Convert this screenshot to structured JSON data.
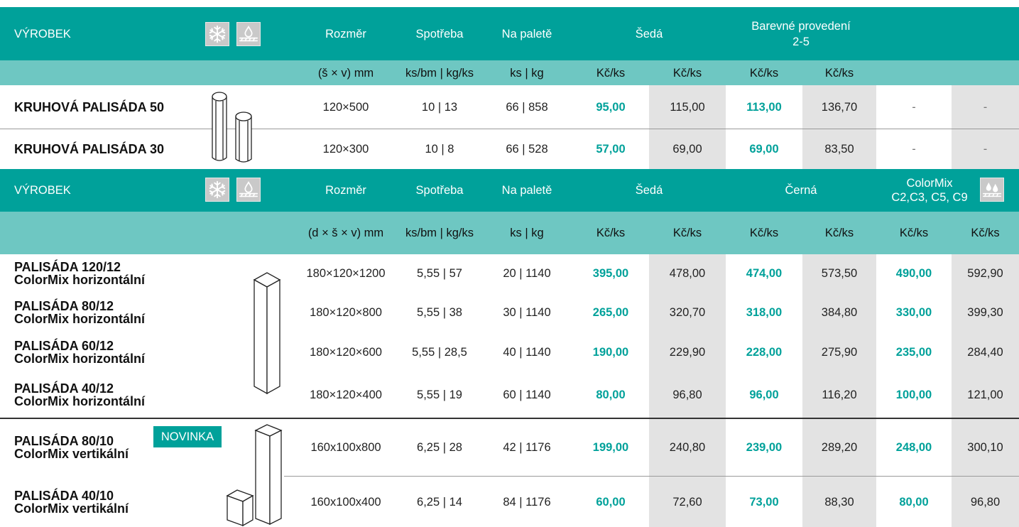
{
  "header1": {
    "vyrobek": "VÝROBEK",
    "rozmer": "Rozměr",
    "spotreba": "Spotřeba",
    "na_palete": "Na paletě",
    "seda": "Šedá",
    "barevne_1": "Barevné provedení",
    "barevne_2": "2-5"
  },
  "subheader1": {
    "rozmer_unit": "(š × v) mm",
    "spotreba_unit": "ks/bm | kg/ks",
    "palete_unit": "ks | kg",
    "price_units": [
      "Kč/ks",
      "Kč/ks",
      "Kč/ks",
      "Kč/ks"
    ]
  },
  "section1_rows": [
    {
      "name": "KRUHOVÁ PALISÁDA 50",
      "rozmer": "120×500",
      "spotreba": "10 | 13",
      "palete": "66 | 858",
      "prices": [
        "95,00",
        "115,00",
        "113,00",
        "136,70",
        "-",
        "-"
      ]
    },
    {
      "name": "KRUHOVÁ PALISÁDA 30",
      "rozmer": "120×300",
      "spotreba": "10 | 8",
      "palete": "66 | 528",
      "prices": [
        "57,00",
        "69,00",
        "69,00",
        "83,50",
        "-",
        "-"
      ]
    }
  ],
  "header2": {
    "vyrobek": "VÝROBEK",
    "rozmer": "Rozměr",
    "spotreba": "Spotřeba",
    "na_palete": "Na paletě",
    "seda": "Šedá",
    "cerna": "Černá",
    "colormix_1": "ColorMix",
    "colormix_2": "C2,C3, C5, C9"
  },
  "subheader2": {
    "rozmer_unit": "(d × š × v) mm",
    "spotreba_unit": "ks/bm | kg/ks",
    "palete_unit": "ks | kg",
    "price_units": [
      "Kč/ks",
      "Kč/ks",
      "Kč/ks",
      "Kč/ks",
      "Kč/ks",
      "Kč/ks"
    ]
  },
  "section2_rows": [
    {
      "name1": "PALISÁDA 120/12",
      "name2": "ColorMix horizontální",
      "rozmer": "180×120×1200",
      "spotreba": "5,55 | 57",
      "palete": "20 | 1140",
      "prices": [
        "395,00",
        "478,00",
        "474,00",
        "573,50",
        "490,00",
        "592,90"
      ]
    },
    {
      "name1": "PALISÁDA 80/12",
      "name2": "ColorMix horizontální",
      "rozmer": "180×120×800",
      "spotreba": "5,55 | 38",
      "palete": "30 | 1140",
      "prices": [
        "265,00",
        "320,70",
        "318,00",
        "384,80",
        "330,00",
        "399,30"
      ]
    },
    {
      "name1": "PALISÁDA 60/12",
      "name2": "ColorMix horizontální",
      "rozmer": "180×120×600",
      "spotreba": "5,55 | 28,5",
      "palete": "40 | 1140",
      "prices": [
        "190,00",
        "229,90",
        "228,00",
        "275,90",
        "235,00",
        "284,40"
      ]
    },
    {
      "name1": "PALISÁDA 40/12",
      "name2": "ColorMix horizontální",
      "rozmer": "180×120×400",
      "spotreba": "5,55 | 19",
      "palete": "60 | 1140",
      "prices": [
        "80,00",
        "96,80",
        "96,00",
        "116,20",
        "100,00",
        "121,00"
      ]
    },
    {
      "name1": "PALISÁDA 80/10",
      "name2": "ColorMix vertikální",
      "rozmer": "160x100x800",
      "spotreba": "6,25 | 28",
      "palete": "42 | 1176",
      "prices": [
        "199,00",
        "240,80",
        "239,00",
        "289,20",
        "248,00",
        "300,10"
      ]
    },
    {
      "name1": "PALISÁDA 40/10",
      "name2": "ColorMix vertikální",
      "rozmer": "160x100x400",
      "spotreba": "6,25 | 14",
      "palete": "84 | 1176",
      "prices": [
        "60,00",
        "72,60",
        "73,00",
        "88,30",
        "80,00",
        "96,80"
      ]
    }
  ],
  "badge": "NOVINKA",
  "icons": [
    "snowflake-icon",
    "water-drop-surface-icon",
    "water-drops-surface-icon"
  ],
  "colors": {
    "teal": "#00a19a",
    "light_teal": "#6ec7c2",
    "gray_column": "#e3e3e3"
  }
}
